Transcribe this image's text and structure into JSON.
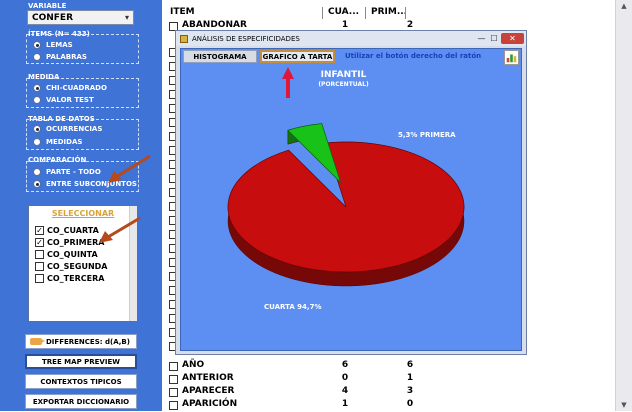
{
  "sidebar": {
    "variable": {
      "label": "VARIABLE",
      "value": "CONFER"
    },
    "items_group": {
      "label": "ÍTEMS (N= 433)",
      "options": [
        "LEMAS",
        "PALABRAS"
      ],
      "selected": 0
    },
    "measure_group": {
      "label": "MEDIDA",
      "options": [
        "CHI-CUADRADO",
        "VALOR TEST"
      ],
      "selected": 0
    },
    "data_table_group": {
      "label": "TABLA DE DATOS",
      "options": [
        "OCURRENCIAS",
        "MEDIDAS"
      ],
      "selected": 0
    },
    "comparison_group": {
      "label": "COMPARACIÓN",
      "options": [
        "PARTE - TODO",
        "ENTRE SUBCONJUNTOS"
      ],
      "selected": 1
    },
    "select_list": {
      "title": "SELECCIONAR",
      "items": [
        {
          "label": "CO_CUARTA",
          "checked": true
        },
        {
          "label": "CO_PRIMERA",
          "checked": true
        },
        {
          "label": "CO_QUINTA",
          "checked": false
        },
        {
          "label": "CO_SEGUNDA",
          "checked": false
        },
        {
          "label": "CO_TERCERA",
          "checked": false
        }
      ]
    },
    "buttons": {
      "differences": "DIFFERENCES: d(A,B)",
      "tree_map": "TREE MAP PREVIEW",
      "contexts": "CONTEXTOS TIPICOS",
      "export": "EXPORTAR DICCIONARIO"
    }
  },
  "table": {
    "headers": [
      "ITEM",
      "CUA...",
      "PRIM..."
    ],
    "top_rows": [
      {
        "word": "ABANDONAR",
        "v1": "1",
        "v2": "2"
      }
    ],
    "bottom_rows": [
      {
        "word": "AÑO",
        "v1": "6",
        "v2": "6"
      },
      {
        "word": "ANTERIOR",
        "v1": "0",
        "v2": "1"
      },
      {
        "word": "APARECER",
        "v1": "4",
        "v2": "3"
      },
      {
        "word": "APARICIÓN",
        "v1": "1",
        "v2": "0"
      }
    ]
  },
  "modal": {
    "title": "ANÁLISIS DE ESPECIFICIDADES",
    "tabs": {
      "histogram": "HISTOGRAMA",
      "pie": "GRAFICO A TARTA"
    },
    "hint": "Utilizar el botón derecho del ratón",
    "close_glyph": "✕",
    "min_glyph": "—",
    "max_glyph": "☐"
  },
  "chart_data": {
    "type": "pie",
    "title": "INFANTIL",
    "subtitle": "(PORCENTUAL)",
    "slices": [
      {
        "label": "CUARTA",
        "value": 94.7,
        "display": "CUARTA  94,7%",
        "color": "#c70d0d"
      },
      {
        "label": "PRIMERA",
        "value": 5.3,
        "display": "5,3%  PRIMERA",
        "color": "#19c219"
      }
    ],
    "exploded": "PRIMERA",
    "style": "3d"
  },
  "colors": {
    "panel_blue": "#3f73d6",
    "chart_bg": "#5d8ff2",
    "accent_orange": "#c58d3f",
    "annotation_arrow": "#b44a1e",
    "pointer_arrow": "#e0163a"
  }
}
